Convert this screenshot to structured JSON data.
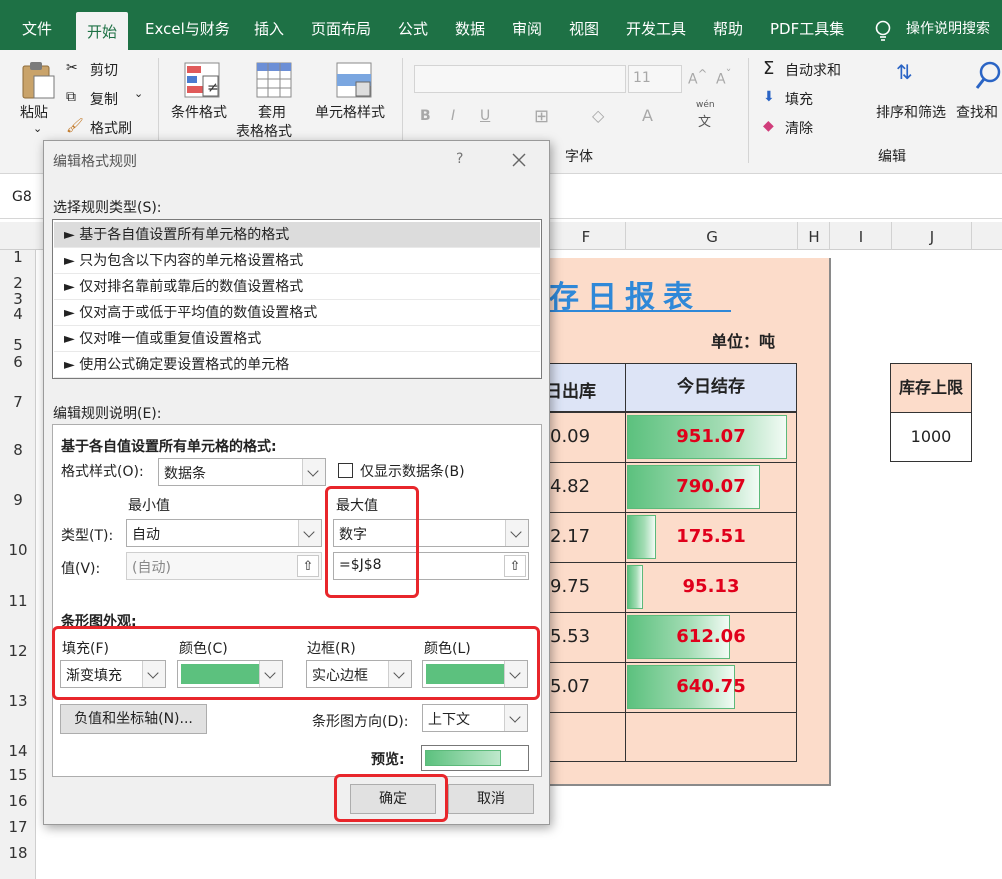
{
  "menu": {
    "tabs": [
      "文件",
      "开始",
      "Excel与财务",
      "插入",
      "页面布局",
      "公式",
      "数据",
      "审阅",
      "视图",
      "开发工具",
      "帮助",
      "PDF工具集"
    ],
    "active_tab": "开始",
    "search": "操作说明搜索"
  },
  "ribbon": {
    "paste": "粘贴",
    "cut": "剪切",
    "copy": "复制",
    "format_painter": "格式刷",
    "conditional_format": "条件格式",
    "table_format_1": "套用",
    "table_format_2": "表格格式",
    "cell_styles": "单元格样式",
    "font_size": "11",
    "font_group": "字体",
    "wen": "wén",
    "wen_char": "文",
    "bold": "B",
    "italic": "I",
    "underline": "U",
    "autosum": "自动求和",
    "fill": "填充",
    "clear": "清除",
    "sort_filter": "排序和筛选",
    "find_select": "查找和",
    "editing_group": "编辑"
  },
  "formula_bar": {
    "name_box": "G8"
  },
  "grid": {
    "columns": [
      "F",
      "G",
      "H",
      "I",
      "J"
    ],
    "rows": [
      "1",
      "2",
      "3",
      "4",
      "5",
      "6",
      "7",
      "8",
      "9",
      "10",
      "11",
      "12",
      "13",
      "14",
      "15",
      "16",
      "17",
      "18"
    ]
  },
  "sheet": {
    "title": "库存日报表",
    "unit": "单位：吨",
    "col_out": "日出库",
    "col_stock": "今日结存",
    "out_values": [
      "0.09",
      "4.82",
      "2.17",
      "9.75",
      "5.53",
      "5.07"
    ],
    "stock_values": [
      951.07,
      790.07,
      175.51,
      95.13,
      612.06,
      640.75
    ],
    "stock_labels": [
      "951.07",
      "790.07",
      "175.51",
      "95.13",
      "612.06",
      "640.75"
    ],
    "limit_header": "库存上限",
    "limit_value": "1000",
    "limit_number": 1000
  },
  "dialog": {
    "title": "编辑格式规则",
    "help": "?",
    "select_rule_label": "选择规则类型(S):",
    "rule_types": [
      "► 基于各自值设置所有单元格的格式",
      "► 只为包含以下内容的单元格设置格式",
      "► 仅对排名靠前或靠后的数值设置格式",
      "► 仅对高于或低于平均值的数值设置格式",
      "► 仅对唯一值或重复值设置格式",
      "► 使用公式确定要设置格式的单元格"
    ],
    "edit_desc_label": "编辑规则说明(E):",
    "desc_heading": "基于各自值设置所有单元格的格式:",
    "format_style_label": "格式样式(O):",
    "format_style_value": "数据条",
    "show_bar_only": "仅显示数据条(B)",
    "min_label": "最小值",
    "max_label": "最大值",
    "type_label": "类型(T):",
    "value_label": "值(V):",
    "min_type": "自动",
    "max_type": "数字",
    "min_value": "(自动)",
    "max_value": "=$J$8",
    "appearance_label": "条形图外观:",
    "fill_label": "填充(F)",
    "fill_color_label": "颜色(C)",
    "border_label": "边框(R)",
    "border_color_label": "颜色(L)",
    "fill_value": "渐变填充",
    "border_value": "实心边框",
    "bar_color": "#5cc17e",
    "neg_axis_button": "负值和坐标轴(N)...",
    "direction_label": "条形图方向(D):",
    "direction_value": "上下文",
    "preview_label": "预览:",
    "ok": "确定",
    "cancel": "取消"
  }
}
